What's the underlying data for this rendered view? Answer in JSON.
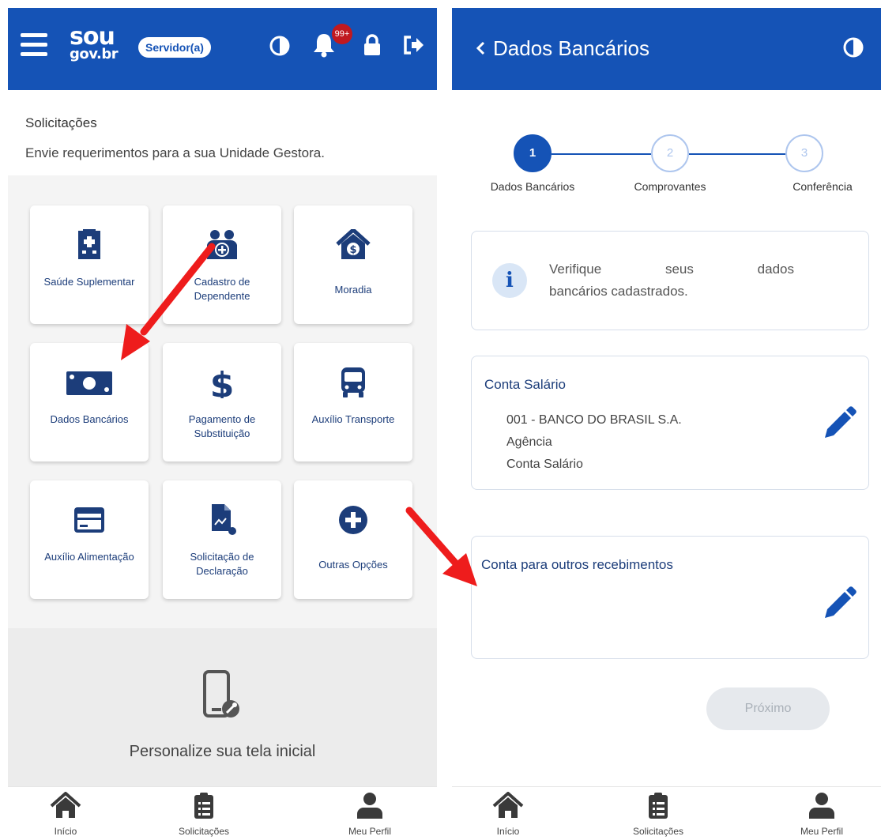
{
  "left": {
    "header": {
      "logo_top": "sou",
      "logo_bottom": "gov.br",
      "badge": "Servidor(a)",
      "notification_count": "99+"
    },
    "intro": {
      "title": "Solicitações",
      "subtitle": "Envie requerimentos para a sua Unidade Gestora."
    },
    "tiles": [
      {
        "label": "Saúde Suplementar",
        "icon": "hospital-icon"
      },
      {
        "label": "Cadastro de Dependente",
        "icon": "dependents-icon"
      },
      {
        "label": "Moradia",
        "icon": "house-money-icon"
      },
      {
        "label": "Dados Bancários",
        "icon": "money-bill-icon"
      },
      {
        "label": "Pagamento de Substituição",
        "icon": "dollar-icon"
      },
      {
        "label": "Auxílio Transporte",
        "icon": "bus-icon"
      },
      {
        "label": "Auxílio Alimentação",
        "icon": "credit-card-icon"
      },
      {
        "label": "Solicitação de Declaração",
        "icon": "document-icon"
      },
      {
        "label": "Outras Opções",
        "icon": "plus-circle-icon"
      }
    ],
    "personalize": {
      "text": "Personalize sua tela inicial"
    },
    "nav": [
      {
        "label": "Início",
        "icon": "home-icon"
      },
      {
        "label": "Solicitações",
        "icon": "clipboard-icon"
      },
      {
        "label": "Meu Perfil",
        "icon": "user-icon"
      }
    ]
  },
  "right": {
    "header": {
      "title": "Dados Bancários"
    },
    "steps": [
      {
        "number": "1",
        "label": "Dados Bancários",
        "active": true
      },
      {
        "number": "2",
        "label": "Comprovantes",
        "active": false
      },
      {
        "number": "3",
        "label": "Conferência",
        "active": false
      }
    ],
    "info": {
      "line1": "Verifique seus dados",
      "line2": "bancários cadastrados."
    },
    "salary_account": {
      "title": "Conta Salário",
      "bank": "001 - BANCO DO BRASIL S.A.",
      "agency": "Agência",
      "account": "Conta Salário"
    },
    "other_account": {
      "title": "Conta para outros recebimentos"
    },
    "next_button": "Próximo",
    "nav": [
      {
        "label": "Início",
        "icon": "home-icon"
      },
      {
        "label": "Solicitações",
        "icon": "clipboard-icon"
      },
      {
        "label": "Meu Perfil",
        "icon": "user-icon"
      }
    ]
  },
  "colors": {
    "brand": "#1553b6",
    "label": "#1c3d7a",
    "notification": "#c0191f",
    "arrow": "#ee1c1c"
  }
}
